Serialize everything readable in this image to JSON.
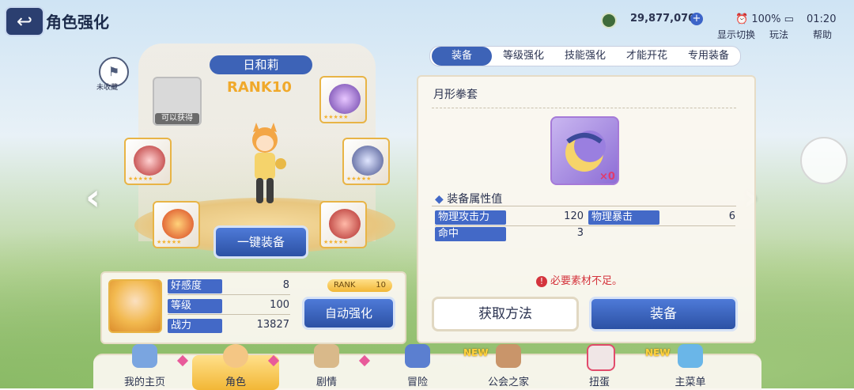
{
  "status_bar": {
    "battery": "100%",
    "time": "01:20"
  },
  "header": {
    "title": "角色强化",
    "gold": "29,877,070",
    "buttons": [
      {
        "label": "显示切换",
        "icon": "display-toggle-icon"
      },
      {
        "label": "玩法",
        "icon": "gameplay-icon"
      },
      {
        "label": "帮助",
        "icon": "help-icon"
      }
    ]
  },
  "character": {
    "name": "日和莉",
    "rank": "RANK10",
    "favorite_label": "未收藏",
    "one_click_equip": "一键装备",
    "obtainable_label": "可以获得"
  },
  "stats": {
    "rows": [
      {
        "label": "好感度",
        "value": "8"
      },
      {
        "label": "等级",
        "value": "100"
      },
      {
        "label": "战力",
        "value": "13827"
      }
    ],
    "rank_label": "RANK",
    "rank_value": "10",
    "auto_enhance": "自动强化"
  },
  "tabs": [
    {
      "label": "装备",
      "active": true
    },
    {
      "label": "等级强化",
      "active": false
    },
    {
      "label": "技能强化",
      "active": false
    },
    {
      "label": "才能开花",
      "active": false
    },
    {
      "label": "专用装备",
      "active": false
    }
  ],
  "equipment": {
    "name": "月形拳套",
    "count": "×0",
    "attr_title": "装备属性值",
    "attrs": [
      {
        "label": "物理攻击力",
        "value": "120"
      },
      {
        "label": "物理暴击",
        "value": "6"
      },
      {
        "label": "命中",
        "value": "3"
      }
    ],
    "warning": "必要素材不足。",
    "get_method": "获取方法",
    "equip": "装备"
  },
  "nav": [
    {
      "label": "我的主页",
      "active": false,
      "new": false
    },
    {
      "label": "角色",
      "active": true,
      "new": false
    },
    {
      "label": "剧情",
      "active": false,
      "new": false
    },
    {
      "label": "冒险",
      "active": false,
      "new": false
    },
    {
      "label": "公会之家",
      "active": false,
      "new": true,
      "badge": "NEW"
    },
    {
      "label": "扭蛋",
      "active": false,
      "new": false
    },
    {
      "label": "主菜单",
      "active": false,
      "new": true,
      "badge": "NEW"
    }
  ],
  "colors": {
    "accent_blue": "#3d63b7",
    "gold": "#f0a92b",
    "warning": "#d4343d"
  }
}
